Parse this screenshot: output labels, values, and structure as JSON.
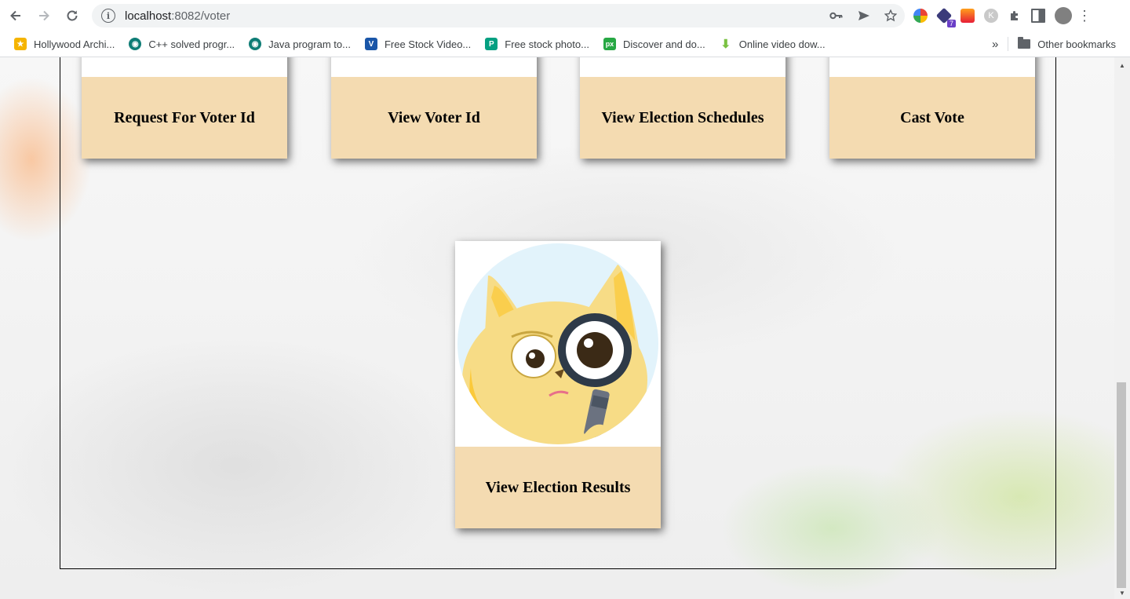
{
  "browser": {
    "url_host": "localhost",
    "url_path": ":8082/voter",
    "bookmarks": [
      {
        "label": "Hollywood Archi...",
        "icon": "hollywood-icon",
        "color": "#f5b400"
      },
      {
        "label": "C++ solved progr...",
        "icon": "pw-icon",
        "color": "#0f7d76"
      },
      {
        "label": "Java program to...",
        "icon": "pw-icon",
        "color": "#0f7d76"
      },
      {
        "label": "Free Stock Video...",
        "icon": "v-icon",
        "color": "#1a56a8"
      },
      {
        "label": "Free stock photo...",
        "icon": "pexels-icon",
        "color": "#05a081"
      },
      {
        "label": "Discover and do...",
        "icon": "px-icon",
        "color": "#27a844"
      },
      {
        "label": "Online video dow...",
        "icon": "download-icon",
        "color": "#7ac142"
      }
    ],
    "overflow_label": "»",
    "other_bookmarks_label": "Other bookmarks",
    "extension_badge": "7"
  },
  "cards": [
    {
      "label": "Request For Voter Id"
    },
    {
      "label": "View Voter Id"
    },
    {
      "label": "View Election Schedules"
    },
    {
      "label": "Cast Vote"
    },
    {
      "label": "View Election Results"
    }
  ],
  "colors": {
    "card_bg": "#f4dbb1",
    "cat_body": "#f7dc86",
    "cat_circle_bg": "#e2f3fb",
    "magnifier_frame": "#2e3a48"
  }
}
